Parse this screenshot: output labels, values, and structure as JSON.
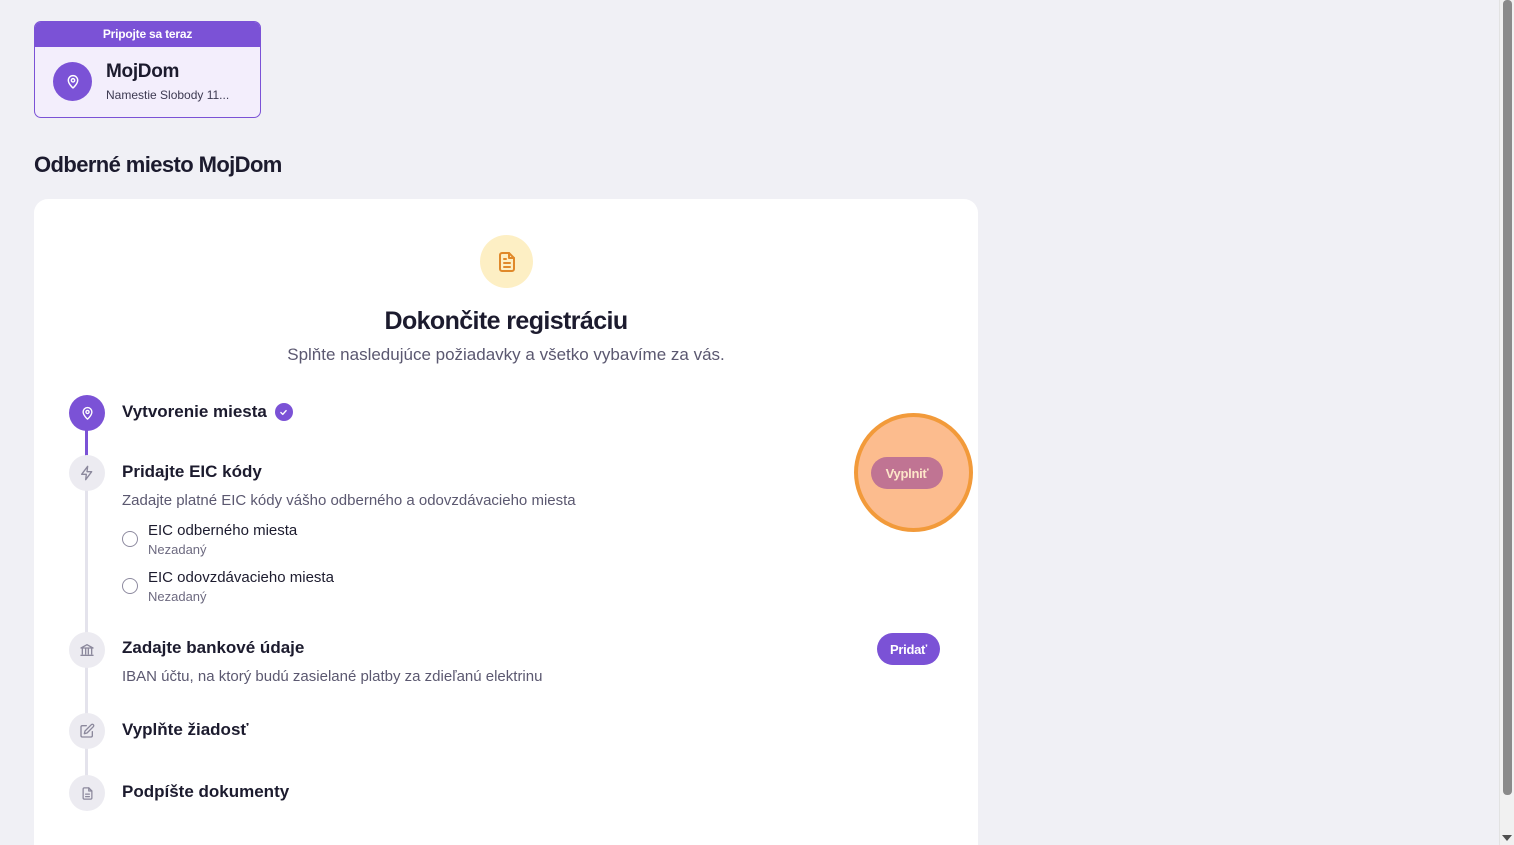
{
  "site_card": {
    "banner": "Pripojte sa teraz",
    "name": "MojDom",
    "address": "Namestie Slobody 11..."
  },
  "page_title": "Odberné miesto MojDom",
  "panel": {
    "heading": "Dokončite registráciu",
    "subheading": "Splňte nasledujúce požiadavky a všetko vybavíme za vás."
  },
  "steps": [
    {
      "title": "Vytvorenie miesta",
      "icon": "location-pin-icon",
      "completed": true
    },
    {
      "title": "Pridajte EIC kódy",
      "icon": "lightning-icon",
      "description": "Zadajte platné EIC kódy vášho odberného a odovzdávacieho miesta",
      "action": "Vyplniť",
      "items": [
        {
          "label": "EIC odberného miesta",
          "status": "Nezadaný"
        },
        {
          "label": "EIC odovzdávacieho miesta",
          "status": "Nezadaný"
        }
      ]
    },
    {
      "title": "Zadajte bankové údaje",
      "icon": "bank-icon",
      "description": "IBAN účtu, na ktorý budú zasielané platby za zdieľanú elektrinu",
      "action": "Pridať"
    },
    {
      "title": "Vyplňte žiadosť",
      "icon": "edit-icon"
    },
    {
      "title": "Podpíšte dokumenty",
      "icon": "document-icon"
    }
  ],
  "colors": {
    "accent": "#7b52d6",
    "background": "#f0f0f5",
    "highlight": "#f29a3a"
  }
}
